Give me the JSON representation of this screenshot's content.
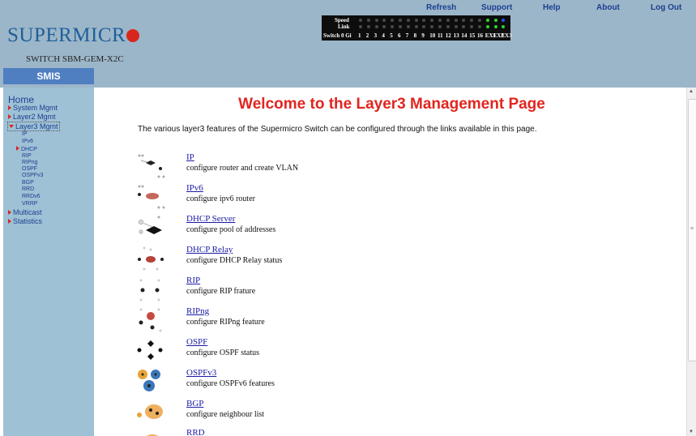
{
  "header": {
    "brand": "SUPERMICR",
    "model": "SWITCH SBM-GEM-X2C",
    "nav": [
      "Refresh",
      "Support",
      "Help",
      "About",
      "Log Out"
    ]
  },
  "ports": {
    "speed_label": "Speed",
    "link_label": "Link",
    "switch_label": "Switch 0 Gi",
    "port_numbers": [
      "1",
      "2",
      "3",
      "4",
      "5",
      "6",
      "7",
      "8",
      "9",
      "10",
      "11",
      "12",
      "13",
      "14",
      "15",
      "16",
      "EX1",
      "EX2",
      "EX3"
    ]
  },
  "sidebar": {
    "title": "SMIS",
    "home": "Home",
    "items": [
      "System Mgmt",
      "Layer2 Mgmt",
      "Layer3 Mgmt"
    ],
    "layer3_subitems": [
      "IP",
      "IPv6",
      "DHCP",
      "RIP",
      "RIPng",
      "OSPF",
      "OSPFv3",
      "BGP",
      "RRD",
      "RRDv6",
      "VRRP"
    ],
    "bottom_items": [
      "Multicast",
      "Statistics"
    ]
  },
  "main": {
    "title": "Welcome to the Layer3 Management Page",
    "intro": "The various layer3 features of the Supermicro Switch can be configured through the links available in this page.",
    "features": [
      {
        "link": "IP",
        "desc": "configure router and create VLAN"
      },
      {
        "link": "IPv6",
        "desc": "configure ipv6 router"
      },
      {
        "link": "DHCP Server",
        "desc": "configure pool of addresses"
      },
      {
        "link": "DHCP Relay",
        "desc": "configure DHCP Relay status"
      },
      {
        "link": "RIP",
        "desc": "configure RIP frature"
      },
      {
        "link": "RIPng",
        "desc": "configure RIPng feature"
      },
      {
        "link": "OSPF",
        "desc": "configure OSPF status"
      },
      {
        "link": "OSPFv3",
        "desc": "configure OSPFv6 features"
      },
      {
        "link": "BGP",
        "desc": "configure neighbour list"
      },
      {
        "link": "RRD",
        "desc": ""
      }
    ]
  },
  "colors": {
    "banner": "#9cb6c9",
    "sidebar": "#9fc1d6",
    "title_red": "#e0261f",
    "link_blue": "#1a1aa6"
  }
}
